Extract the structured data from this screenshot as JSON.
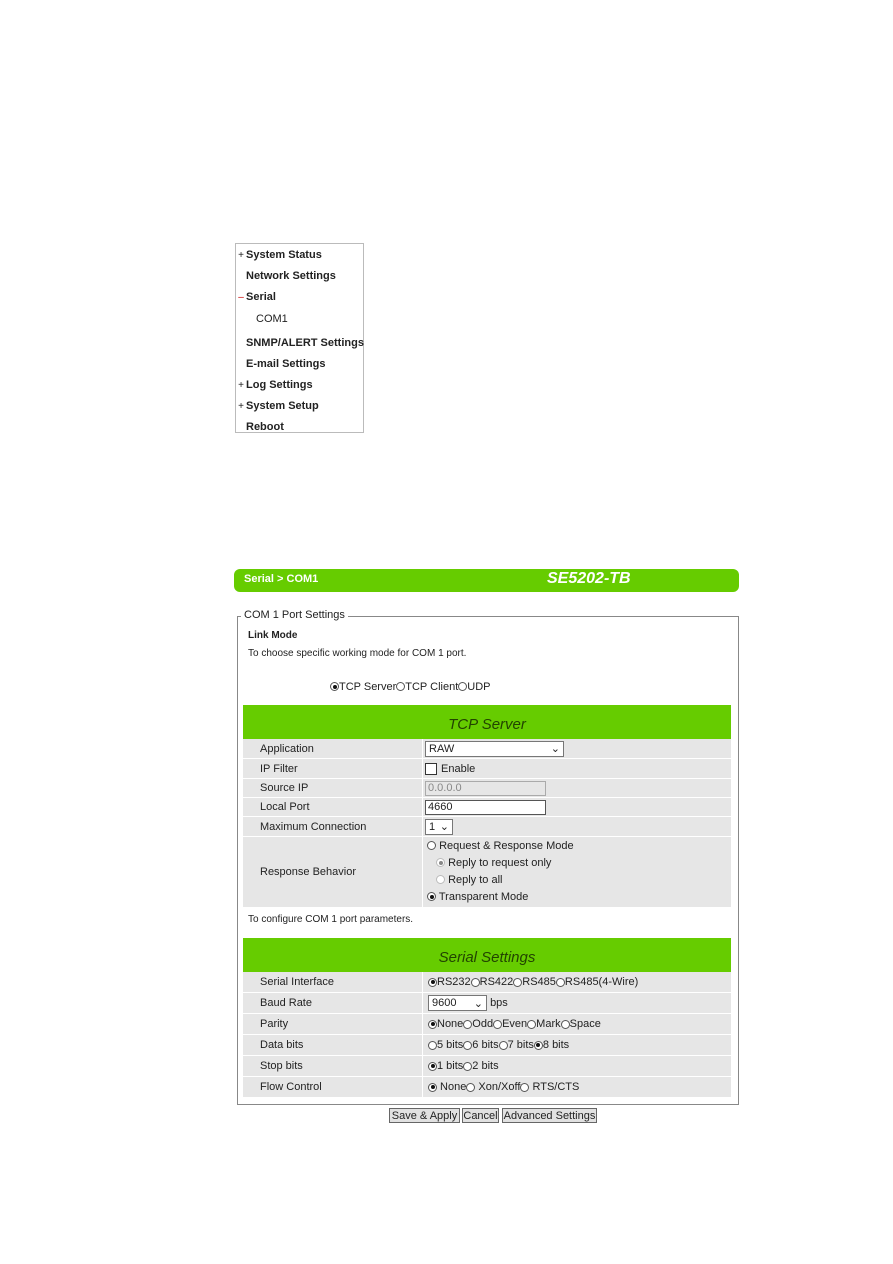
{
  "menu": {
    "items": [
      {
        "prefix": "+",
        "label": "System Status"
      },
      {
        "prefix": "",
        "label": "Network Settings"
      },
      {
        "prefix": "–",
        "label": "Serial"
      },
      {
        "prefix": "",
        "label": "COM1"
      },
      {
        "prefix": "",
        "label": "SNMP/ALERT Settings"
      },
      {
        "prefix": "",
        "label": "E-mail Settings"
      },
      {
        "prefix": "+",
        "label": "Log Settings"
      },
      {
        "prefix": "+",
        "label": "System Setup"
      },
      {
        "prefix": "",
        "label": "Reboot"
      }
    ]
  },
  "header": {
    "breadcrumb": "Serial > COM1",
    "model": "SE5202-TB",
    "color": "#66cc00"
  },
  "fieldset": {
    "legend": "COM 1 Port Settings"
  },
  "link_mode": {
    "title": "Link Mode",
    "desc": "To choose specific working mode for COM 1 port.",
    "options": [
      "TCP Server",
      "TCP Client",
      "UDP"
    ],
    "selected": "TCP Server"
  },
  "tcp_server": {
    "title": "TCP Server",
    "application": {
      "label": "Application",
      "value": "RAW"
    },
    "ip_filter": {
      "label": "IP Filter",
      "checkbox": "Enable",
      "checked": false
    },
    "source_ip": {
      "label": "Source IP",
      "value": "0.0.0.0"
    },
    "local_port": {
      "label": "Local Port",
      "value": "4660"
    },
    "max_conn": {
      "label": "Maximum Connection",
      "value": "1"
    },
    "response": {
      "label": "Response Behavior",
      "opt1": "Request & Response Mode",
      "sub1": "Reply to request only",
      "sub2": "Reply to all",
      "opt2": "Transparent Mode",
      "selected": "Transparent Mode"
    }
  },
  "configure_text": "To configure COM 1 port parameters.",
  "serial": {
    "title": "Serial Settings",
    "interface": {
      "label": "Serial Interface",
      "options": [
        "RS232",
        "RS422",
        "RS485",
        "RS485(4-Wire)"
      ],
      "selected": "RS232"
    },
    "baud": {
      "label": "Baud Rate",
      "value": "9600",
      "unit": "bps"
    },
    "parity": {
      "label": "Parity",
      "options": [
        "None",
        "Odd",
        "Even",
        "Mark",
        "Space"
      ],
      "selected": "None"
    },
    "data_bits": {
      "label": "Data bits",
      "options": [
        "5 bits",
        "6 bits",
        "7 bits",
        "8 bits"
      ],
      "selected": "8 bits"
    },
    "stop_bits": {
      "label": "Stop bits",
      "options": [
        "1 bits",
        "2 bits"
      ],
      "selected": "1 bits"
    },
    "flow": {
      "label": "Flow Control",
      "options": [
        " None",
        " Xon/Xoff",
        " RTS/CTS"
      ],
      "selected": " None"
    }
  },
  "buttons": {
    "save": "Save & Apply",
    "cancel": "Cancel",
    "advanced": "Advanced Settings"
  }
}
